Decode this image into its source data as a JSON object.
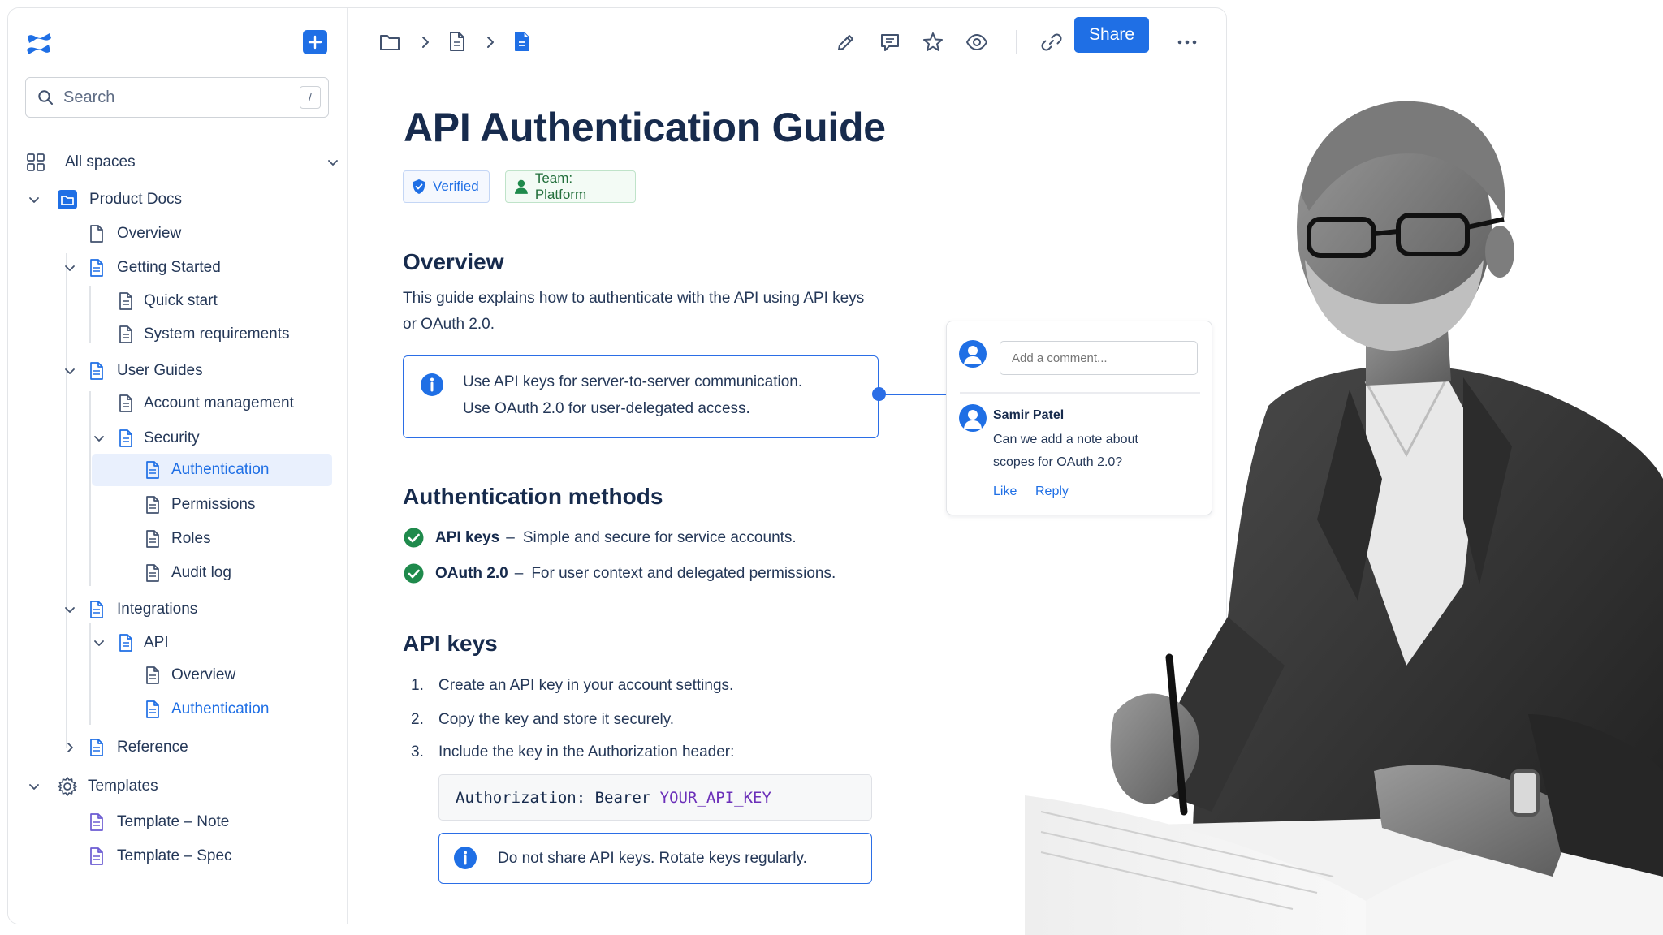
{
  "sidebar": {
    "search_placeholder": "Search",
    "search_shortcut": "/",
    "all_spaces": "All spaces",
    "space_name": "Product Docs",
    "items": {
      "overview": "Overview",
      "getting_started": "Getting Started",
      "quick_start": "Quick start",
      "system_requirements": "System requirements",
      "user_guides": "User Guides",
      "account_management": "Account management",
      "security": "Security",
      "authentication": "Authentication",
      "permissions": "Permissions",
      "roles": "Roles",
      "audit_log": "Audit log",
      "integrations": "Integrations",
      "api": "API",
      "api_overview": "Overview",
      "api_authentication": "Authentication",
      "reference": "Reference",
      "templates": "Templates",
      "template_note": "Template – Note",
      "template_spec": "Template – Spec"
    }
  },
  "toolbar": {
    "share_label": "Share"
  },
  "page": {
    "title": "API Authentication Guide",
    "badges": {
      "verified": "Verified",
      "team": "Team: Platform"
    },
    "overview": {
      "heading": "Overview",
      "line1": "This guide explains how to authenticate with the API using API keys",
      "line2": "or OAuth 2.0.",
      "callout_line1": "Use API keys for server-to-server communication.",
      "callout_line2": "Use OAuth 2.0 for user-delegated access."
    },
    "methods": {
      "heading": "Authentication methods",
      "items": [
        {
          "term": "API keys",
          "dash": "–",
          "desc": "Simple and secure for service accounts."
        },
        {
          "term": "OAuth 2.0",
          "dash": "–",
          "desc": "For user context and delegated permissions."
        }
      ]
    },
    "api_keys": {
      "heading": "API keys",
      "steps": [
        {
          "num": "1.",
          "text": "Create an API key in your account settings."
        },
        {
          "num": "2.",
          "text": "Copy the key and store it securely."
        },
        {
          "num": "3.",
          "text": "Include the key in the Authorization header:"
        }
      ],
      "code_prefix": "Authorization: Bearer ",
      "code_key": "YOUR_API_KEY",
      "warning": "Do not share API keys. Rotate keys regularly."
    }
  },
  "comments": {
    "input_placeholder": "Add a comment...",
    "author": "Samir Patel",
    "text_line1": "Can we add a note about",
    "text_line2": "scopes for OAuth 2.0?",
    "like_label": "Like",
    "reply_label": "Reply"
  },
  "colors": {
    "accent": "#1f6fe5",
    "success": "#1f8a4c",
    "code_keyword": "#6b2fb9"
  },
  "icons": {
    "logo": "confluence-logo",
    "page": "page-icon",
    "folder": "folder-icon",
    "edit": "pencil-icon",
    "comment": "comment-icon",
    "star": "star-icon",
    "watch": "eye-icon",
    "link": "link-icon",
    "more": "more-icon"
  }
}
